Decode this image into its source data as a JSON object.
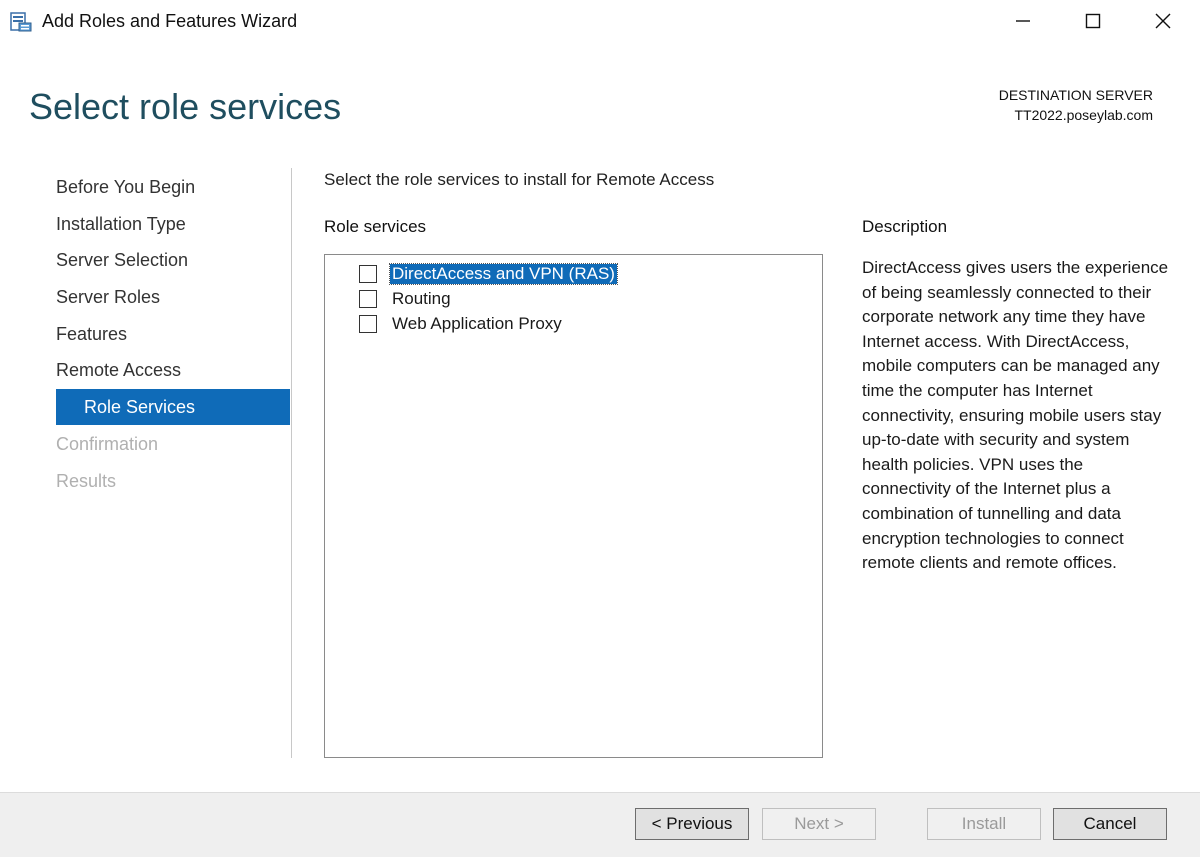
{
  "window": {
    "title": "Add Roles and Features Wizard"
  },
  "header": {
    "page_title": "Select role services",
    "destination_label": "DESTINATION SERVER",
    "destination_server": "TT2022.poseylab.com"
  },
  "nav": {
    "items": [
      {
        "label": "Before You Begin",
        "state": "normal"
      },
      {
        "label": "Installation Type",
        "state": "normal"
      },
      {
        "label": "Server Selection",
        "state": "normal"
      },
      {
        "label": "Server Roles",
        "state": "normal"
      },
      {
        "label": "Features",
        "state": "normal"
      },
      {
        "label": "Remote Access",
        "state": "normal"
      },
      {
        "label": "Role Services",
        "state": "selected"
      },
      {
        "label": "Confirmation",
        "state": "disabled"
      },
      {
        "label": "Results",
        "state": "disabled"
      }
    ]
  },
  "main": {
    "instruction": "Select the role services to install for Remote Access",
    "role_services_heading": "Role services",
    "role_services": [
      {
        "label": "DirectAccess and VPN (RAS)",
        "checked": false,
        "highlighted": true
      },
      {
        "label": "Routing",
        "checked": false,
        "highlighted": false
      },
      {
        "label": "Web Application Proxy",
        "checked": false,
        "highlighted": false
      }
    ],
    "description_heading": "Description",
    "description_text": "DirectAccess gives users the experience of being seamlessly connected to their corporate network any time they have Internet access. With DirectAccess, mobile computers can be managed any time the computer has Internet connectivity, ensuring mobile users stay up-to-date with security and system health policies. VPN uses the connectivity of the Internet plus a combination of tunnelling and data encryption technologies to connect remote clients and remote offices."
  },
  "footer": {
    "previous_label": "< Previous",
    "next_label": "Next >",
    "install_label": "Install",
    "cancel_label": "Cancel"
  },
  "colors": {
    "accent": "#0f6bb8",
    "title_color": "#1f4e5f",
    "disabled_text": "#b0b0b0",
    "footer_bg": "#efefef"
  },
  "icons": {
    "app": "server-manager-icon",
    "minimize": "minimize-icon",
    "maximize": "maximize-icon",
    "close": "close-icon"
  }
}
